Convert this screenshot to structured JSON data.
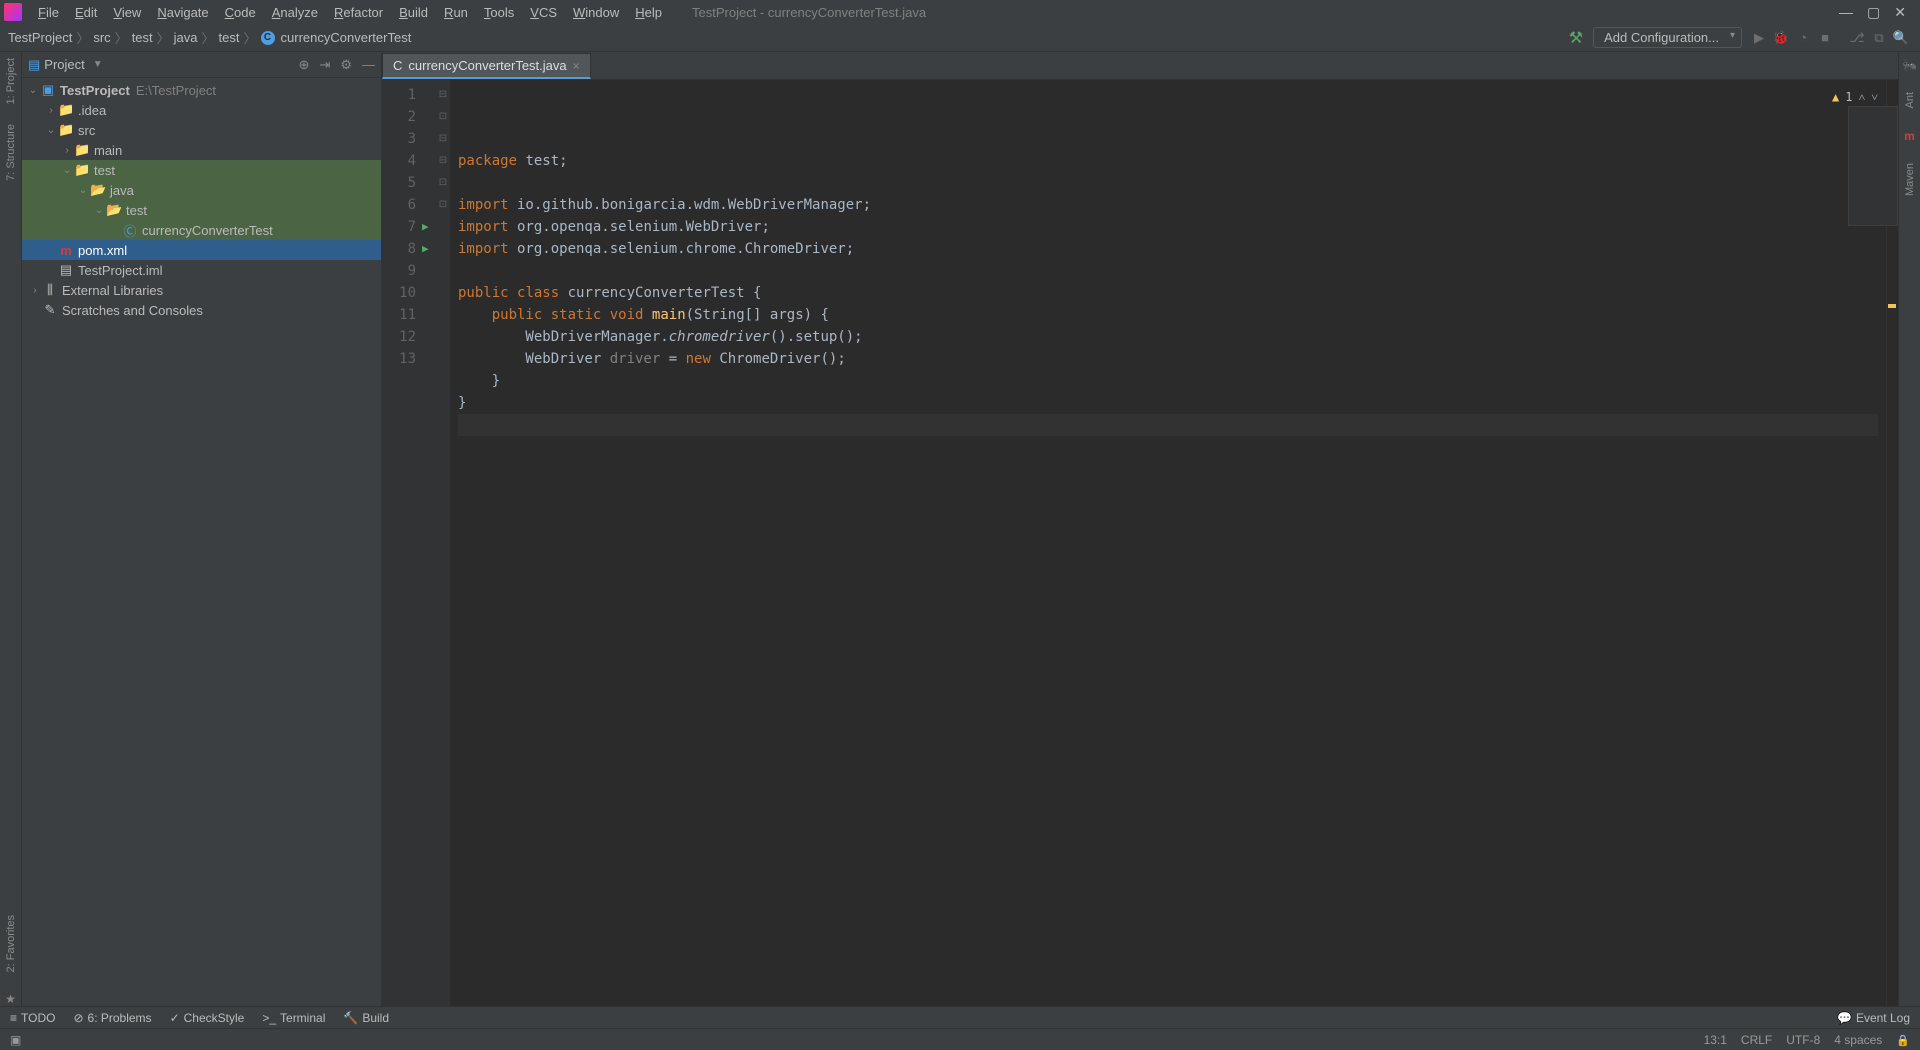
{
  "window": {
    "title": "TestProject - currencyConverterTest.java"
  },
  "menu": [
    "File",
    "Edit",
    "View",
    "Navigate",
    "Code",
    "Analyze",
    "Refactor",
    "Build",
    "Run",
    "Tools",
    "VCS",
    "Window",
    "Help"
  ],
  "breadcrumb": [
    "TestProject",
    "src",
    "test",
    "java",
    "test",
    "currencyConverterTest"
  ],
  "run_config": {
    "label": "Add Configuration..."
  },
  "sidebar": {
    "title": "Project",
    "tree": {
      "root": "TestProject",
      "root_path": "E:\\TestProject",
      "items": [
        {
          "indent": 1,
          "arrow": ">",
          "kind": "folder",
          "label": ".idea"
        },
        {
          "indent": 1,
          "arrow": "v",
          "kind": "folder",
          "label": "src"
        },
        {
          "indent": 2,
          "arrow": ">",
          "kind": "folder",
          "label": "main"
        },
        {
          "indent": 2,
          "arrow": "v",
          "kind": "folder",
          "label": "test",
          "hl": true
        },
        {
          "indent": 3,
          "arrow": "v",
          "kind": "pkg",
          "label": "java",
          "hl": true
        },
        {
          "indent": 4,
          "arrow": "v",
          "kind": "pkg",
          "label": "test",
          "hl": true
        },
        {
          "indent": 5,
          "arrow": "",
          "kind": "class",
          "label": "currencyConverterTest",
          "hl": true
        },
        {
          "indent": 1,
          "arrow": "",
          "kind": "maven",
          "label": "pom.xml",
          "selected": true
        },
        {
          "indent": 1,
          "arrow": "",
          "kind": "file",
          "label": "TestProject.iml"
        }
      ],
      "extra": [
        {
          "indent": 0,
          "arrow": ">",
          "kind": "lib",
          "label": "External Libraries"
        },
        {
          "indent": 0,
          "arrow": "",
          "kind": "scratch",
          "label": "Scratches and Consoles"
        }
      ]
    }
  },
  "tabs": [
    {
      "label": "currencyConverterTest.java",
      "active": true
    }
  ],
  "editor": {
    "lines": [
      {
        "n": 1,
        "html": "<span class='kw'>package</span> test;"
      },
      {
        "n": 2,
        "html": ""
      },
      {
        "n": 3,
        "html": "<span class='kw'>import</span> io.github.bonigarcia.wdm.WebDriverManager;",
        "fold": "⊟"
      },
      {
        "n": 4,
        "html": "<span class='kw'>import</span> org.openqa.selenium.WebDriver;"
      },
      {
        "n": 5,
        "html": "<span class='kw'>import</span> org.openqa.selenium.chrome.ChromeDriver;",
        "fold": "⊡"
      },
      {
        "n": 6,
        "html": ""
      },
      {
        "n": 7,
        "html": "<span class='kw'>public</span> <span class='kw'>class</span> currencyConverterTest {",
        "run": true,
        "fold": "⊟"
      },
      {
        "n": 8,
        "html": "    <span class='kw'>public</span> <span class='kw'>static</span> <span class='kw'>void</span> <span class='fn'>main</span>(String[] args) {",
        "run": true,
        "fold": "⊟"
      },
      {
        "n": 9,
        "html": "        WebDriverManager.<span class='it'>chromedriver</span>().setup();"
      },
      {
        "n": 10,
        "html": "        WebDriver <span class='unused'>driver</span> = <span class='kw'>new</span> ChromeDriver();"
      },
      {
        "n": 11,
        "html": "    }",
        "fold": "⊡"
      },
      {
        "n": 12,
        "html": "}",
        "fold": "⊡"
      },
      {
        "n": 13,
        "html": "",
        "cursor": true
      }
    ],
    "inspections": {
      "warnings": 1
    }
  },
  "left_rail": [
    "1: Project",
    "7: Structure"
  ],
  "right_rail": [
    "Ant",
    "Maven"
  ],
  "left_rail_bottom": "2: Favorites",
  "bottom_tools": [
    {
      "icon": "≡",
      "label": "TODO"
    },
    {
      "icon": "⊘",
      "label": "6: Problems"
    },
    {
      "icon": "✓",
      "label": "CheckStyle"
    },
    {
      "icon": ">_",
      "label": "Terminal"
    },
    {
      "icon": "🔨",
      "label": "Build"
    }
  ],
  "event_log": "Event Log",
  "status": {
    "caret": "13:1",
    "line_sep": "CRLF",
    "encoding": "UTF-8",
    "indent": "4 spaces"
  }
}
